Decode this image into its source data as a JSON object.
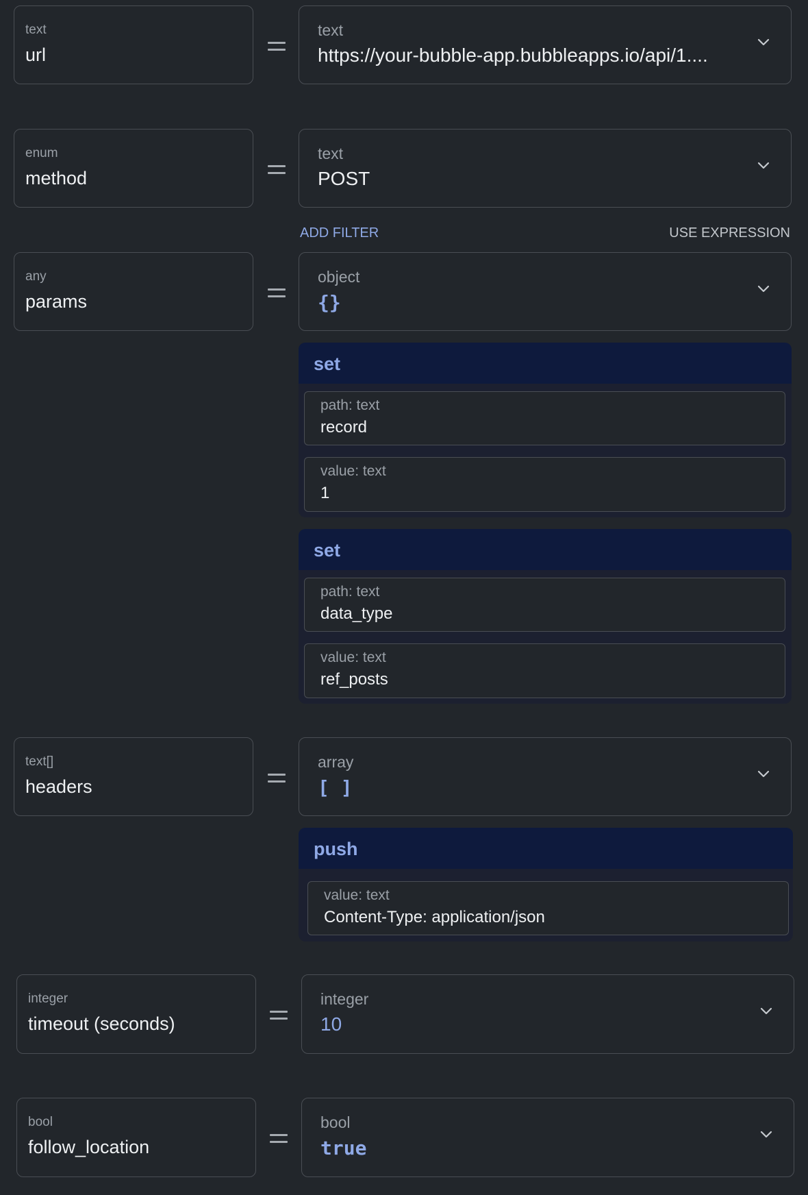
{
  "fields": [
    {
      "type": "text",
      "name": "url",
      "value_type": "text",
      "value": "https://your-bubble-app.bubbleapps.io/api/1...."
    },
    {
      "type": "enum",
      "name": "method",
      "value_type": "text",
      "value": "POST"
    },
    {
      "type": "any",
      "name": "params",
      "value_type": "object",
      "value": "{}"
    },
    {
      "type": "text[]",
      "name": "headers",
      "value_type": "array",
      "value": "[ ]"
    },
    {
      "type": "integer",
      "name": "timeout (seconds)",
      "value_type": "integer",
      "value": "10"
    },
    {
      "type": "bool",
      "name": "follow_location",
      "value_type": "bool",
      "value": "true"
    }
  ],
  "links": {
    "add_filter": "ADD FILTER",
    "use_expression": "USE EXPRESSION"
  },
  "params_ops": [
    {
      "op": "set",
      "path_label": "path: text",
      "path": "record",
      "value_label": "value: text",
      "value": "1"
    },
    {
      "op": "set",
      "path_label": "path: text",
      "path": "data_type",
      "value_label": "value: text",
      "value": "ref_posts"
    }
  ],
  "headers_ops": [
    {
      "op": "push",
      "value_label": "value: text",
      "value": "Content-Type: application/json"
    }
  ],
  "colors": {
    "background": "#22262b",
    "accent": "#8fa9e6",
    "op_header": "#0e1a3d",
    "border": "#4a4e54"
  },
  "icons": {
    "dropdown": "chevron-down-icon",
    "equals": "equals-icon"
  }
}
